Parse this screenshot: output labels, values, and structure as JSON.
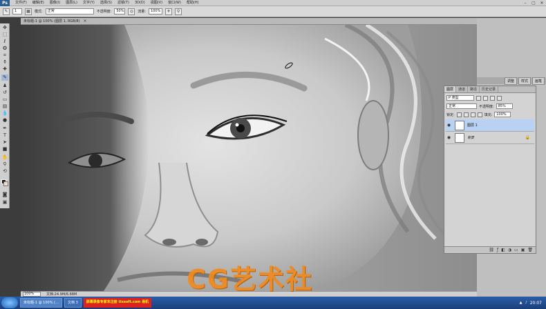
{
  "app": {
    "logo": "Ps"
  },
  "menu": [
    "文件(F)",
    "编辑(E)",
    "图像(I)",
    "图层(L)",
    "文字(Y)",
    "选择(S)",
    "滤镜(T)",
    "3D(D)",
    "视图(V)",
    "窗口(W)",
    "帮助(H)"
  ],
  "window_controls": [
    "–",
    "▢",
    "✕"
  ],
  "options": {
    "brush_size": "1",
    "mode_label": "模式:",
    "mode_value": "正常",
    "opacity_label": "不透明度:",
    "opacity_value": "50%",
    "flow_label": "流量:",
    "flow_value": "100%"
  },
  "document": {
    "tab_title": "未标题-1 @ 100% (图层 1, RGB/8)",
    "close": "×"
  },
  "status": {
    "zoom": "100%",
    "doc_info": "文档:24.9M/6.68M"
  },
  "dock": {
    "buttons": [
      "调整",
      "样式",
      "画笔"
    ]
  },
  "layers_panel": {
    "tabs": [
      "图层",
      "通道",
      "路径",
      "历史记录"
    ],
    "filter_label": "P 类型",
    "blend_mode": "正常",
    "opacity_label": "不透明度:",
    "opacity_value": "85%",
    "lock_label": "锁定:",
    "fill_label": "填充:",
    "fill_value": "100%",
    "layers": [
      {
        "name": "图层 1",
        "selected": true,
        "visible": true
      },
      {
        "name": "背景",
        "selected": false,
        "visible": true,
        "locked": true
      }
    ],
    "footer_icons": [
      "link-icon",
      "fx-icon",
      "mask-icon",
      "adjust-icon",
      "folder-icon",
      "new-layer-icon",
      "trash-icon"
    ]
  },
  "watermark": "CG艺术社",
  "taskbar": {
    "tasks": [
      "未标题-1 @ 100% (…",
      "文档 3"
    ],
    "promo": "屏幕录像专家未注册 tlxsoft.com 易机",
    "clock": "20:07"
  }
}
